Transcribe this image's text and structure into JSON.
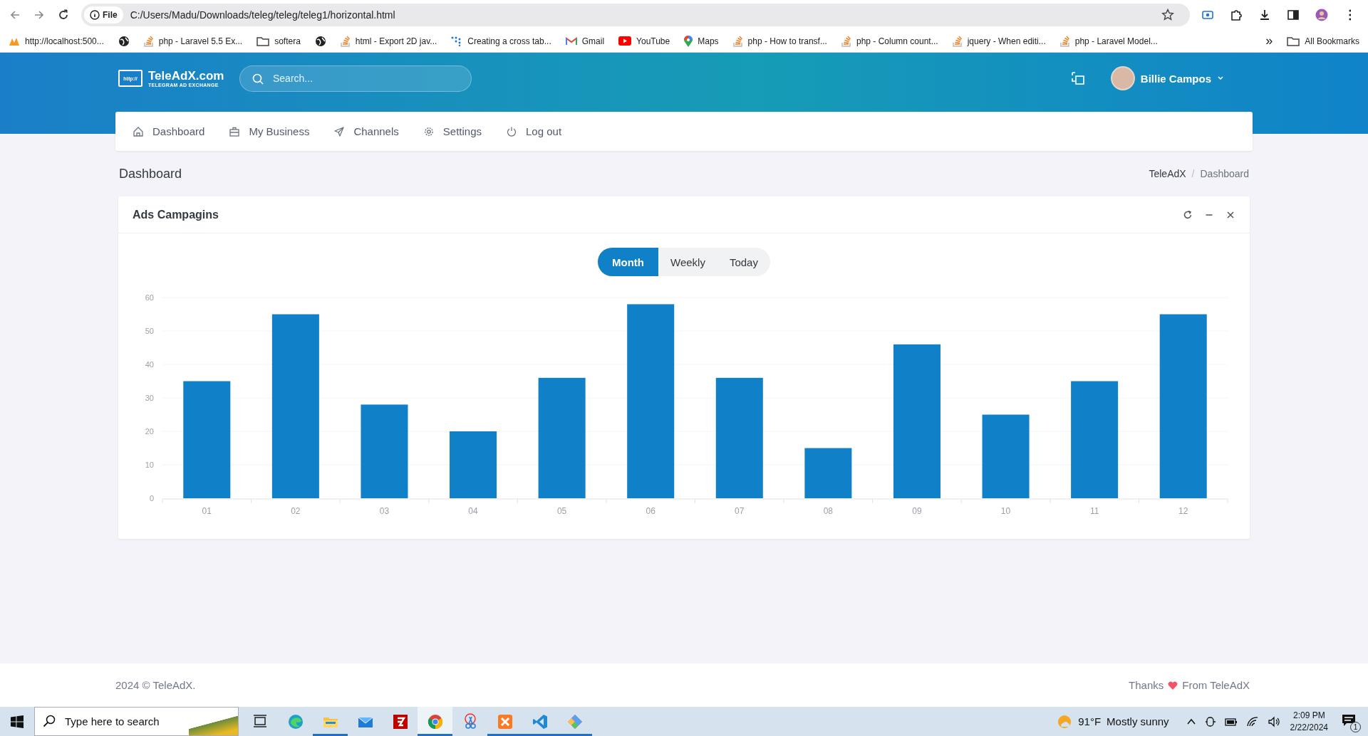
{
  "browser": {
    "address_label": "File",
    "url": "C:/Users/Madu/Downloads/teleg/teleg/teleg1/horizontal.html",
    "bookmarks": [
      {
        "kind": "pma",
        "label": "http://localhost:500..."
      },
      {
        "kind": "globe"
      },
      {
        "kind": "stack",
        "label": "php - Laravel 5.5 Ex..."
      },
      {
        "kind": "folder",
        "label": "softera"
      },
      {
        "kind": "globe"
      },
      {
        "kind": "stack",
        "label": "html - Export 2D jav..."
      },
      {
        "kind": "dots",
        "label": "Creating a cross tab..."
      },
      {
        "kind": "gmail",
        "label": "Gmail"
      },
      {
        "kind": "youtube",
        "label": "YouTube"
      },
      {
        "kind": "maps",
        "label": "Maps"
      },
      {
        "kind": "stack",
        "label": "php - How to transf..."
      },
      {
        "kind": "stack",
        "label": "php - Column count..."
      },
      {
        "kind": "stack",
        "label": "jquery - When editi..."
      },
      {
        "kind": "stack",
        "label": "php - Laravel Model..."
      }
    ],
    "more": "»",
    "all_bookmarks": "All Bookmarks"
  },
  "header": {
    "logo_badge": "http://",
    "logo": "TeleAdX.com",
    "logo_tagline": "TELEGRAM AD EXCHANGE",
    "search": {
      "placeholder": "Search..."
    },
    "user": "Billie Campos"
  },
  "nav": [
    {
      "kind": "home",
      "label": "Dashboard"
    },
    {
      "kind": "briefcase",
      "label": "My Business"
    },
    {
      "kind": "send",
      "label": "Channels"
    },
    {
      "kind": "gear",
      "label": "Settings"
    },
    {
      "kind": "power",
      "label": "Log out"
    }
  ],
  "page_title": "Dashboard",
  "breadcrumb": {
    "separator": "/",
    "items": [
      {
        "label": "TeleAdX"
      },
      {
        "label": "Dashboard"
      }
    ]
  },
  "card": {
    "title": "Ads Campagins",
    "tabs": [
      {
        "label": "Month",
        "selected": true
      },
      {
        "label": "Weekly",
        "selected": false
      },
      {
        "label": "Today",
        "selected": false
      }
    ],
    "chart_data": {
      "type": "bar",
      "categories": [
        "01",
        "02",
        "03",
        "04",
        "05",
        "06",
        "07",
        "08",
        "09",
        "10",
        "11",
        "12"
      ],
      "grid": true,
      "series": [
        {
          "color": "#1081c8",
          "values": [
            35,
            55,
            28,
            20,
            36,
            58,
            36,
            15,
            46,
            25,
            35,
            55
          ]
        }
      ],
      "ylim": [
        0,
        60
      ],
      "yticks": [
        0,
        10,
        20,
        30,
        40,
        50,
        60
      ]
    }
  },
  "footer": {
    "copyright": "2024 © TeleAdX.",
    "thanks": "Thanks",
    "from": "From TeleAdX"
  },
  "taskbar": {
    "search": {
      "placeholder": "Type here to search"
    },
    "apps": [
      {
        "kind": "taskview",
        "running": false,
        "selected": false
      },
      {
        "kind": "edge",
        "running": false,
        "selected": false
      },
      {
        "kind": "explorer",
        "running": true,
        "selected": false
      },
      {
        "kind": "mail",
        "running": false,
        "selected": false
      },
      {
        "kind": "filezilla",
        "running": false,
        "selected": false
      },
      {
        "kind": "chrome",
        "running": true,
        "selected": true
      },
      {
        "kind": "snip",
        "running": false,
        "selected": false
      },
      {
        "kind": "xampp",
        "running": true,
        "selected": false
      },
      {
        "kind": "vscode",
        "running": true,
        "selected": false
      },
      {
        "kind": "git",
        "running": true,
        "selected": false
      }
    ],
    "temperature": "91°F",
    "weather": "Mostly sunny",
    "time": "2:09 PM",
    "date": "2/22/2024",
    "notifications": "1"
  }
}
